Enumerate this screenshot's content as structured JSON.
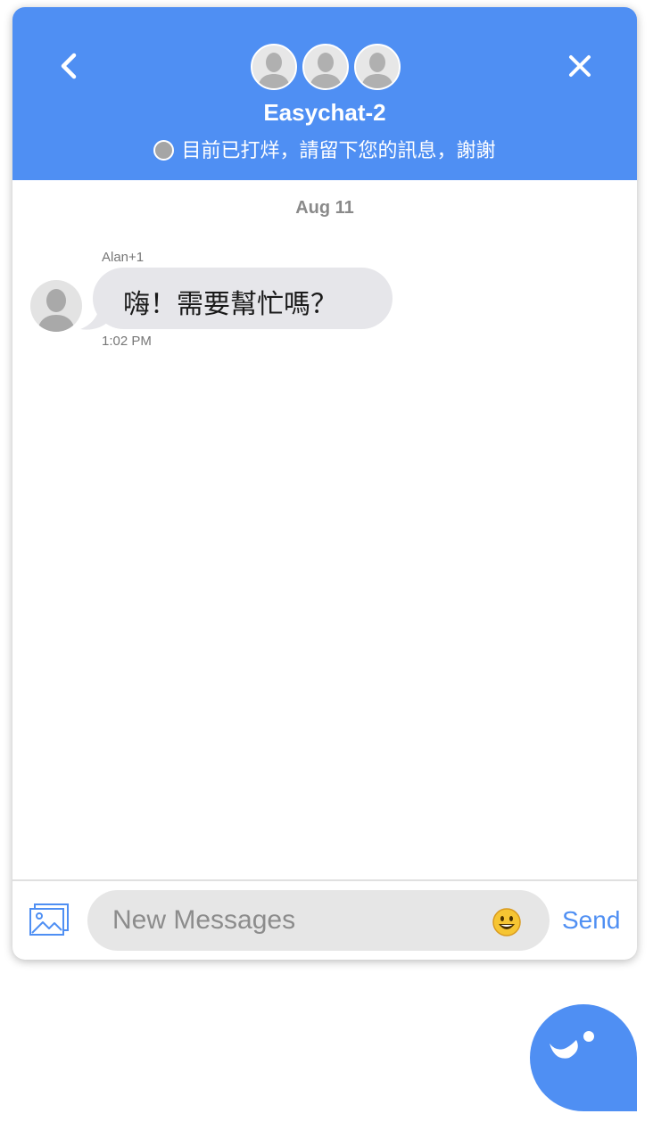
{
  "header": {
    "title": "Easychat-2",
    "status_text": "目前已打烊，請留下您的訊息，謝謝"
  },
  "conversation": {
    "date_separator": "Aug 11",
    "messages": [
      {
        "sender": "Alan+1",
        "text": "嗨！需要幫忙嗎？",
        "time": "1:02 PM"
      }
    ]
  },
  "composer": {
    "placeholder": "New Messages",
    "send_label": "Send"
  },
  "colors": {
    "brand": "#4f8ff3",
    "bubble": "#e6e6ea",
    "status_dot": "#a5a5a5"
  },
  "icons": {
    "back": "chevron-left-icon",
    "close": "close-icon",
    "image": "image-icon",
    "emoji": "smiley-emoji-icon",
    "launcher": "smiley-chat-icon"
  }
}
